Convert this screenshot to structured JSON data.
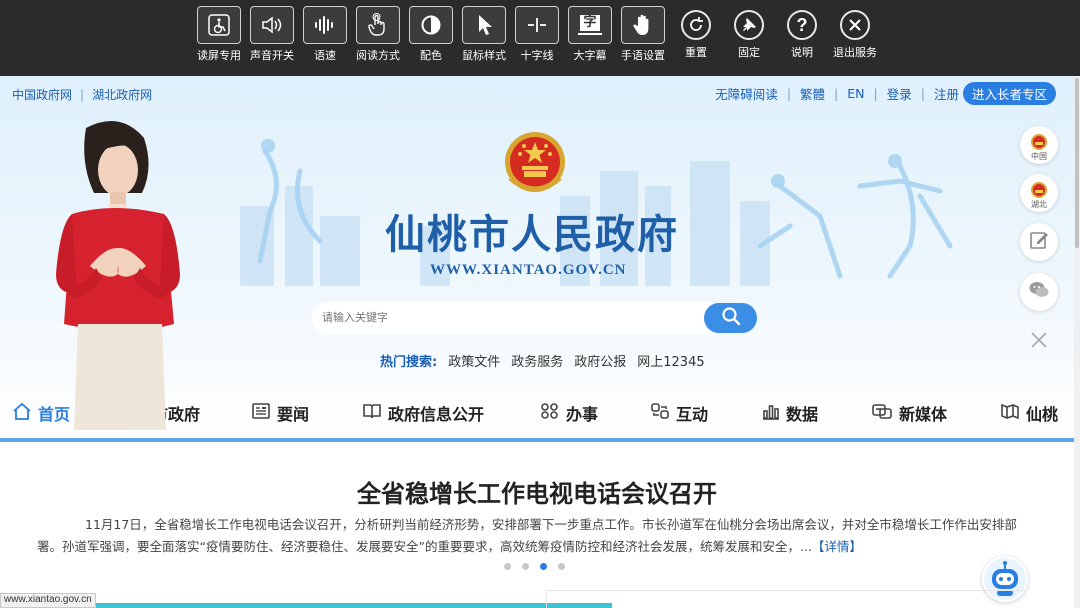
{
  "toolbar": {
    "items": [
      {
        "label": "读屏专用",
        "icon": "wheelchair-icon"
      },
      {
        "label": "声音开关",
        "icon": "speaker-icon"
      },
      {
        "label": "语速",
        "icon": "waveform-icon"
      },
      {
        "label": "阅读方式",
        "icon": "hand-pointer-icon"
      },
      {
        "label": "配色",
        "icon": "contrast-icon"
      },
      {
        "label": "鼠标样式",
        "icon": "cursor-icon"
      },
      {
        "label": "十字线",
        "icon": "crosshair-icon"
      },
      {
        "label": "大字幕",
        "icon": "caption-icon",
        "glyph": "字"
      },
      {
        "label": "手语设置",
        "icon": "hand-icon"
      },
      {
        "label": "重置",
        "icon": "reset-icon"
      },
      {
        "label": "固定",
        "icon": "pin-icon"
      },
      {
        "label": "说明",
        "icon": "help-icon"
      },
      {
        "label": "退出服务",
        "icon": "exit-icon"
      }
    ]
  },
  "header": {
    "left_links": [
      "中国政府网",
      "湖北政府网"
    ],
    "right_links": [
      "无障碍阅读",
      "繁體",
      "EN",
      "登录",
      "注册"
    ],
    "elder_button": "进入长者专区",
    "title": "仙桃市人民政府",
    "url": "WWW.XIANTAO.GOV.CN"
  },
  "search": {
    "placeholder": "请输入关键字",
    "hot_label": "热门搜索:",
    "hot_items": [
      "政策文件",
      "政务服务",
      "政府公报",
      "网上12345"
    ]
  },
  "side_float": {
    "china": "中国",
    "hubei": "湖北"
  },
  "nav": {
    "items": [
      {
        "label": "首页",
        "icon": "home-icon"
      },
      {
        "label": "市政府",
        "icon": "building-icon"
      },
      {
        "label": "要闻",
        "icon": "newspaper-icon"
      },
      {
        "label": "政府信息公开",
        "icon": "book-icon"
      },
      {
        "label": "办事",
        "icon": "grid-icon"
      },
      {
        "label": "互动",
        "icon": "interact-icon"
      },
      {
        "label": "数据",
        "icon": "bar-chart-icon"
      },
      {
        "label": "新媒体",
        "icon": "media-icon"
      },
      {
        "label": "仙桃",
        "icon": "map-icon"
      }
    ]
  },
  "news": {
    "title": "全省稳增长工作电视电话会议召开",
    "body": "11月17日，全省稳增长工作电视电话会议召开，分析研判当前经济形势，安排部署下一步重点工作。市长孙道军在仙桃分会场出席会议，并对全市稳增长工作作出安排部署。孙道军强调，要全面落实“疫情要防住、经济要稳住、发展要安全”的重要要求，高效统筹疫情防控和经济社会发展，统筹发展和安全，...",
    "more": "【详情】",
    "carousel_total": 4,
    "carousel_active": 3
  },
  "status_bar": {
    "url": "www.xiantao.gov.cn"
  }
}
